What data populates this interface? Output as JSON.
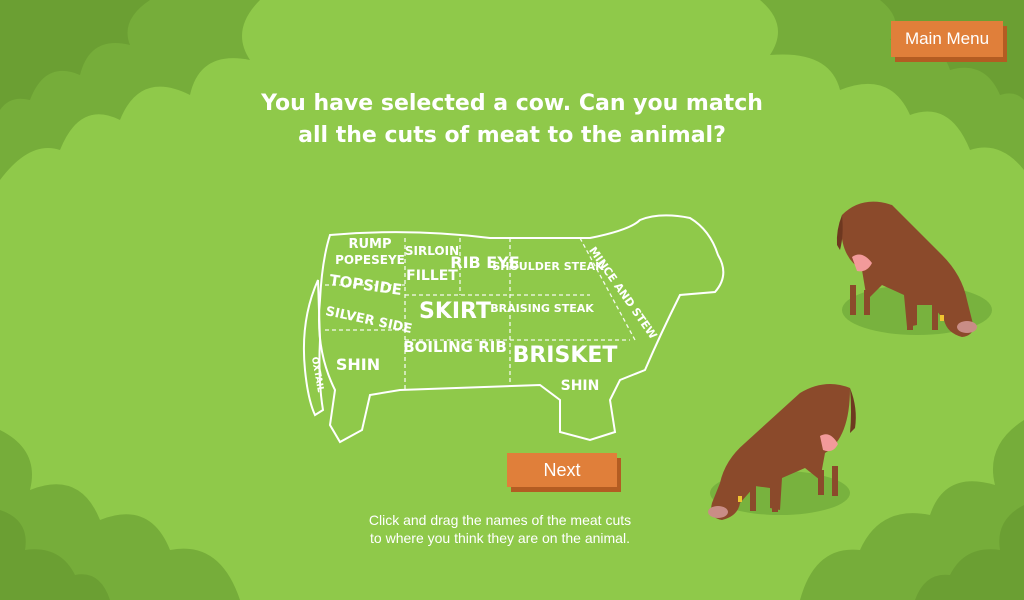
{
  "header": {
    "main_menu_label": "Main Menu"
  },
  "prompt": {
    "line1": "You have selected a cow. Can you match",
    "line2": "all the cuts of meat to the animal?"
  },
  "diagram": {
    "cuts": [
      {
        "id": "rump",
        "label": "RUMP"
      },
      {
        "id": "popeseye",
        "label": "POPESEYE"
      },
      {
        "id": "topside",
        "label": "TOPSIDE"
      },
      {
        "id": "silverside",
        "label": "SILVER SIDE"
      },
      {
        "id": "oxtail",
        "label": "OXTAIL"
      },
      {
        "id": "shin-rear",
        "label": "SHIN"
      },
      {
        "id": "sirloin",
        "label": "SIRLOIN"
      },
      {
        "id": "fillet",
        "label": "FILLET"
      },
      {
        "id": "rib-eye",
        "label": "RIB EYE"
      },
      {
        "id": "skirt",
        "label": "SKIRT"
      },
      {
        "id": "boiling-rib",
        "label": "BOILING RIB"
      },
      {
        "id": "shoulder-steak",
        "label": "SHOULDER STEAK"
      },
      {
        "id": "braising-steak",
        "label": "BRAISING STEAK"
      },
      {
        "id": "brisket",
        "label": "BRISKET"
      },
      {
        "id": "mince-and-stew",
        "label": "MINCE AND STEW"
      },
      {
        "id": "shin-front",
        "label": "SHIN"
      }
    ]
  },
  "navigation": {
    "next_label": "Next"
  },
  "instructions": {
    "line1": "Click and drag the names of the meat cuts",
    "line2": "to where you think they are on the animal."
  },
  "colors": {
    "background": "#8fc94a",
    "button": "#e07f3a",
    "button_shadow": "#b35c22",
    "cow_body": "#8b4a2b"
  }
}
